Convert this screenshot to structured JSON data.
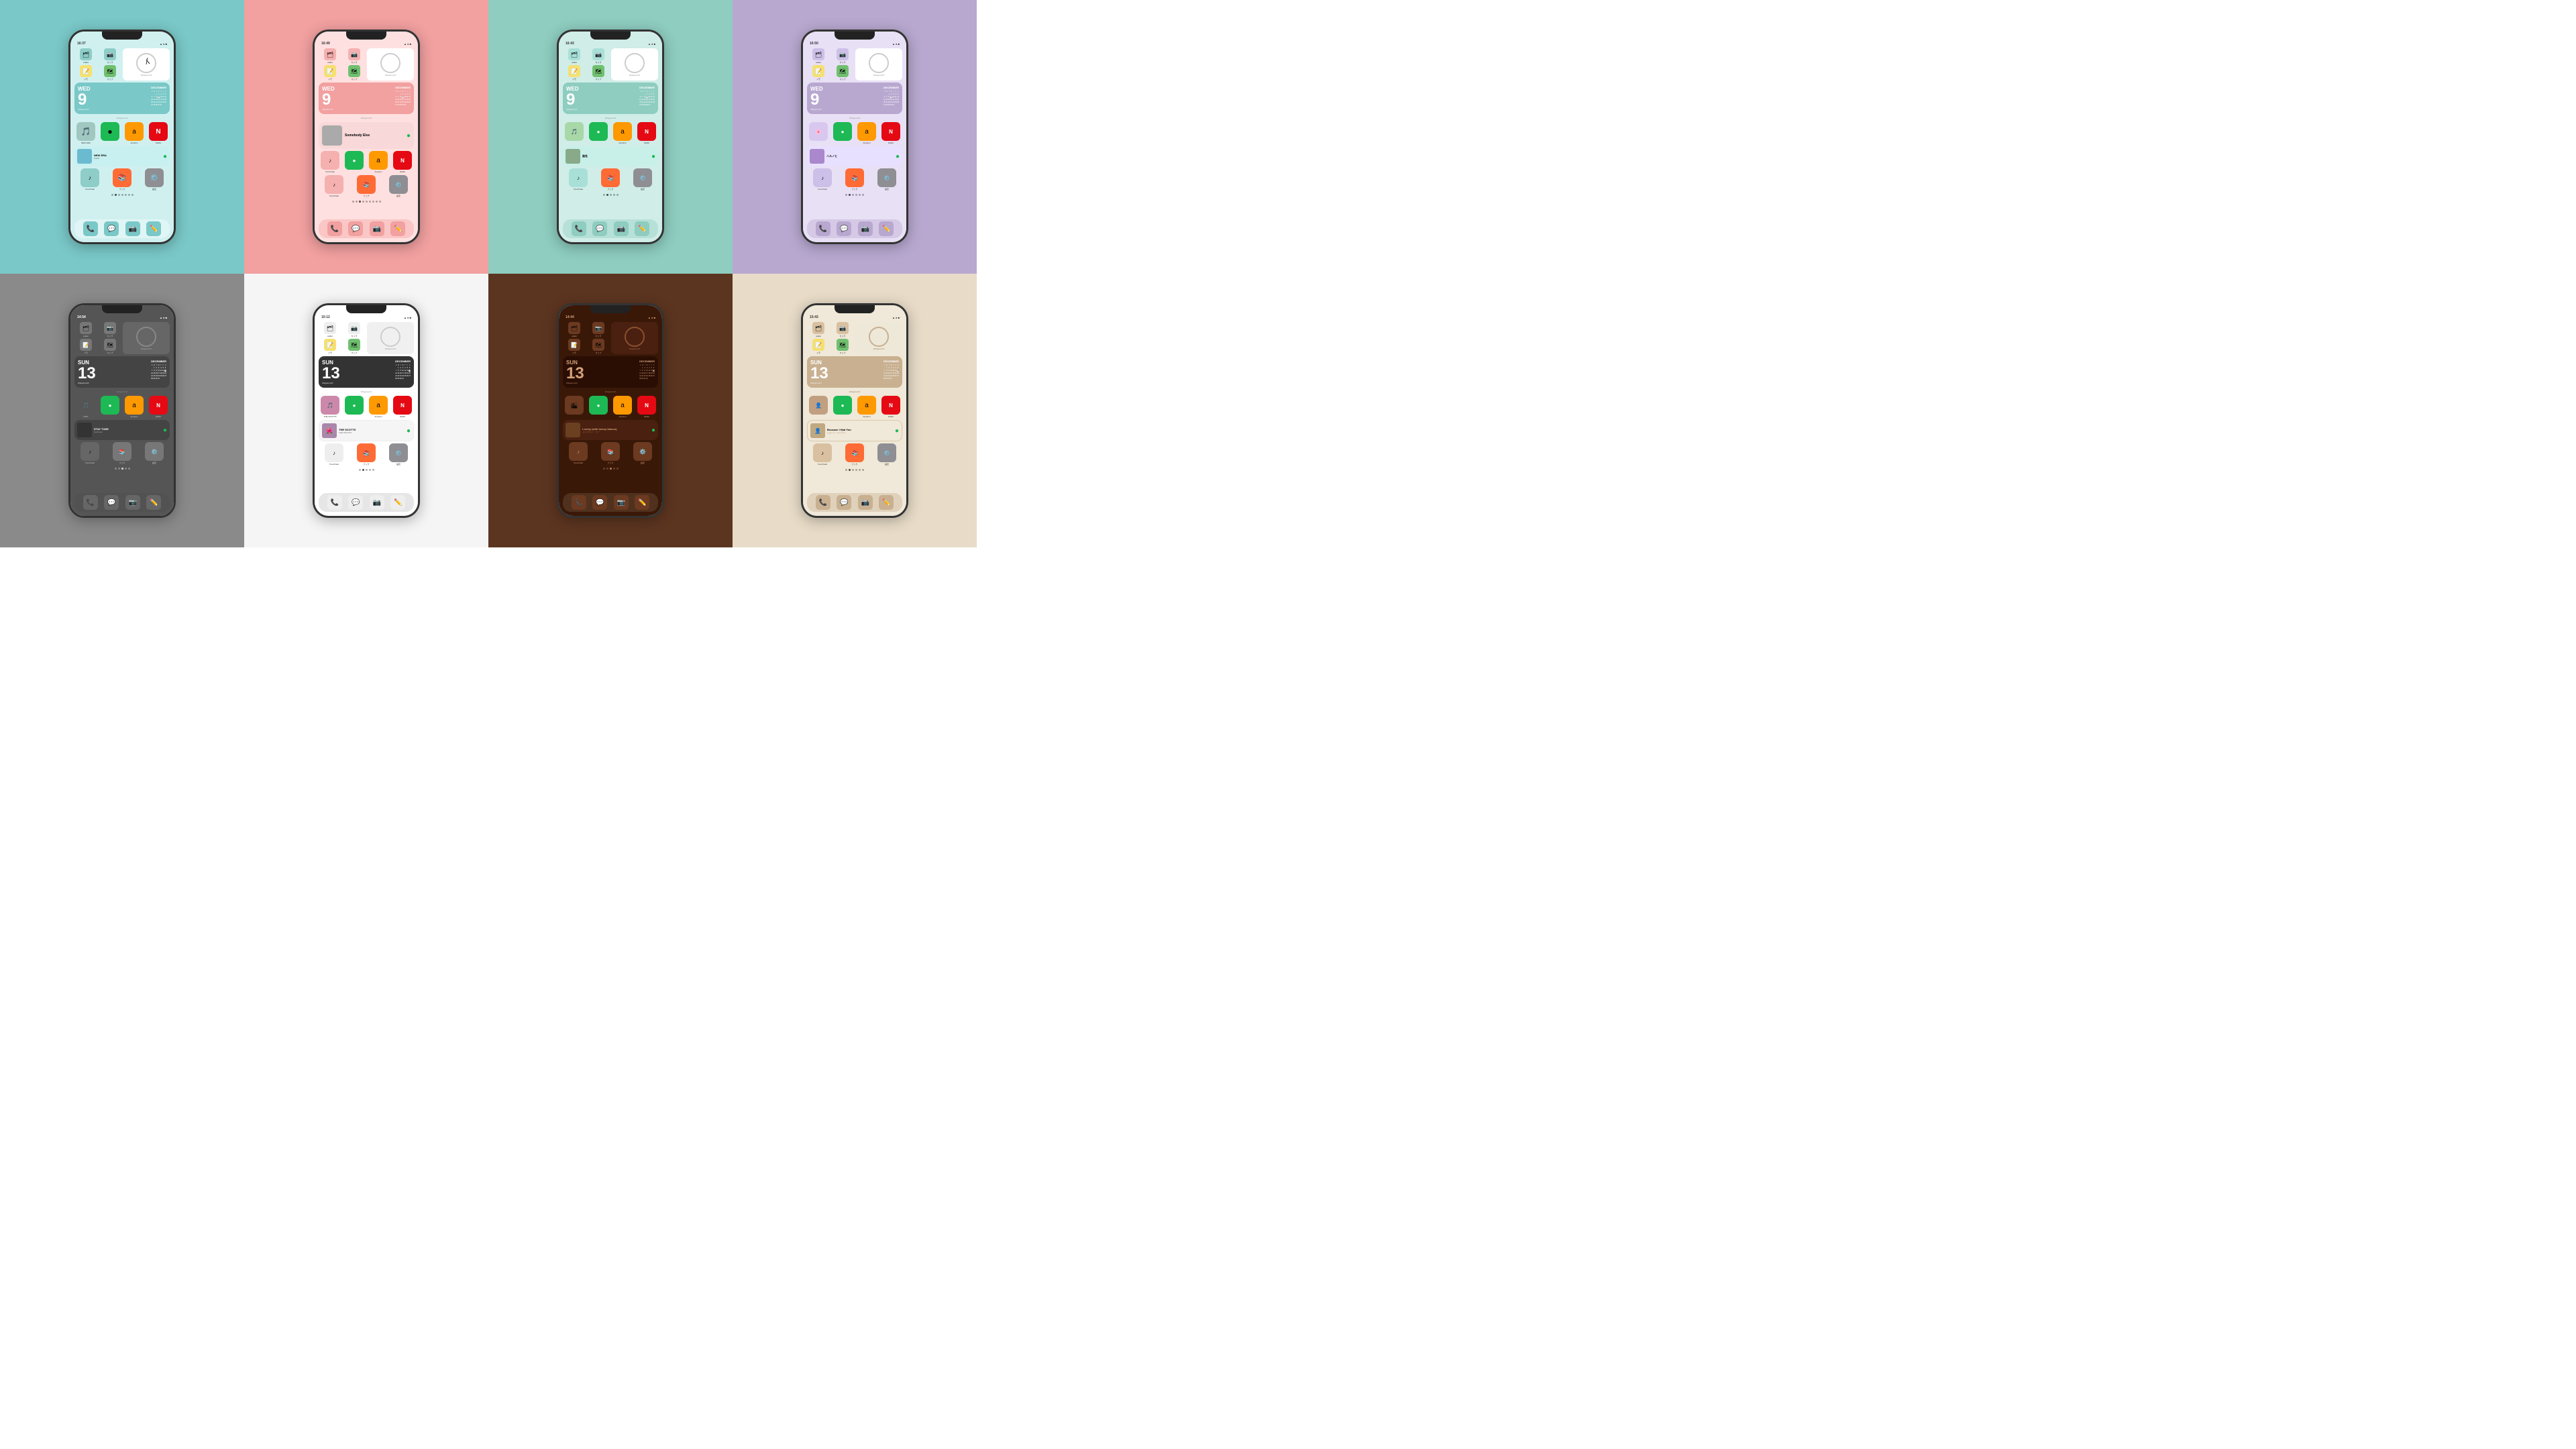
{
  "cells": [
    {
      "id": "teal",
      "bgClass": "cell-teal",
      "screenClass": "screen-teal",
      "themeClass": "theme-teal",
      "statusTime": "16:37",
      "calDay": "WED",
      "calNum": "9",
      "calMonth": "DECEMBER",
      "musicTitle": "NEW ERA",
      "musicArtist": "NuEst",
      "musicColor": "#6BBBD0",
      "dockItems": [
        "📞",
        "💬",
        "📷",
        "✏️"
      ],
      "dockBg": "rgba(255,255,255,0.4)",
      "period": "wed",
      "topRow": [
        "wallet",
        "カメラ",
        "",
        "メモ",
        "マップ",
        "Widgetsmith"
      ],
      "appRow": [
        "TuneTrack",
        "ブック",
        "設定"
      ]
    },
    {
      "id": "pink",
      "bgClass": "cell-pink",
      "screenClass": "screen-pink",
      "themeClass": "theme-pink",
      "statusTime": "16:49",
      "calDay": "WED",
      "calNum": "9",
      "calMonth": "DECEMBER",
      "musicTitle": "Somebody Else",
      "musicArtist": "",
      "musicColor": "#AAAAAA",
      "dockItems": [
        "📞",
        "💬",
        "📷",
        "✏️"
      ],
      "period": "wed"
    },
    {
      "id": "mint",
      "bgClass": "cell-mint",
      "screenClass": "screen-mint",
      "themeClass": "theme-mint",
      "statusTime": "16:43",
      "calDay": "WED",
      "calNum": "9",
      "calMonth": "DECEMBER",
      "musicTitle": "",
      "musicArtist": "",
      "musicColor": "#88AA88",
      "dockItems": [
        "📞",
        "💬",
        "📷",
        "✏️"
      ],
      "period": "wed"
    },
    {
      "id": "lavender",
      "bgClass": "cell-lavender",
      "screenClass": "screen-lavender",
      "themeClass": "theme-lavender",
      "statusTime": "16:50",
      "calDay": "WED",
      "calNum": "9",
      "calMonth": "DECEMBER",
      "musicTitle": "ハルノヒ",
      "musicArtist": "",
      "musicColor": "#AA88CC",
      "dockItems": [
        "📞",
        "💬",
        "📷",
        "✏️"
      ],
      "period": "wed"
    },
    {
      "id": "gray",
      "bgClass": "cell-gray",
      "screenClass": "screen-gray",
      "themeClass": "theme-gray",
      "statusTime": "14:54",
      "calDay": "SUN",
      "calNum": "13",
      "calMonth": "DECEMBER",
      "musicTitle": "STAY TUNE",
      "musicArtist": "Suchmos",
      "musicColor": "#333",
      "dockItems": [
        "📞",
        "💬",
        "📷",
        "✏️"
      ],
      "period": "sun"
    },
    {
      "id": "white",
      "bgClass": "cell-white",
      "screenClass": "screen-white",
      "themeClass": "theme-white",
      "statusTime": "15:12",
      "calDay": "SUN",
      "calNum": "13",
      "calMonth": "DECEMBER",
      "musicTitle": "THE SCOTTS",
      "musicArtist": "THE SCOTTS",
      "musicColor": "#AA88AA",
      "dockItems": [
        "📞",
        "💬",
        "📷",
        "✏️"
      ],
      "period": "sun"
    },
    {
      "id": "brown",
      "bgClass": "cell-brown",
      "screenClass": "screen-brown",
      "themeClass": "theme-brown",
      "statusTime": "14:44",
      "calDay": "SUN",
      "calNum": "13",
      "calMonth": "DECEMBER",
      "musicTitle": "Lonely (with benny blanco)",
      "musicArtist": "ジャスティン・ビー...",
      "musicColor": "#6B4020",
      "dockItems": [
        "📞",
        "💬",
        "📷",
        "✏️"
      ],
      "period": "sun"
    },
    {
      "id": "beige",
      "bgClass": "cell-beige",
      "screenClass": "screen-beige",
      "themeClass": "theme-beige",
      "statusTime": "15:43",
      "calDay": "SUN",
      "calNum": "13",
      "calMonth": "DECEMBER",
      "musicTitle": "Because I Had You",
      "musicArtist": "ショーン・メンデス",
      "musicColor": "#C0A880",
      "dockItems": [
        "📞",
        "💬",
        "📷",
        "✏️"
      ],
      "period": "sun"
    }
  ],
  "calData": {
    "wed": {
      "month": "DECEMBER",
      "days": [
        "S",
        "M",
        "T",
        "W",
        "T",
        "F",
        "S",
        "",
        "",
        "1",
        "2",
        "3",
        "4",
        "5",
        "6",
        "7",
        "8",
        "9",
        "10",
        "11",
        "12",
        "13",
        "14",
        "15",
        "16",
        "17",
        "18",
        "19",
        "20",
        "21",
        "22",
        "23",
        "24",
        "25",
        "26",
        "27",
        "28",
        "29",
        "30",
        "31"
      ],
      "today": "9"
    },
    "sun": {
      "month": "DECEMBER",
      "days": [
        "S",
        "M",
        "T",
        "W",
        "T",
        "F",
        "S",
        "",
        "1",
        "2",
        "3",
        "4",
        "5",
        "6",
        "7",
        "8",
        "9",
        "10",
        "11",
        "12",
        "13",
        "14",
        "15",
        "16",
        "17",
        "18",
        "19",
        "20",
        "21",
        "22",
        "23",
        "24",
        "25",
        "26",
        "27",
        "28",
        "29",
        "30",
        "31"
      ],
      "today": "13"
    }
  },
  "labels": {
    "wallet": "wallet",
    "camera": "カメラ",
    "memo": "メモ",
    "map": "マップ",
    "widgetsmith": "Widgetsmith",
    "amazon": "Amazon",
    "netflix": "Netflix",
    "tunetrack": "TuneTrack",
    "book": "ブック",
    "settings": "設定",
    "widgetsmith2": "Widgetsmith"
  }
}
